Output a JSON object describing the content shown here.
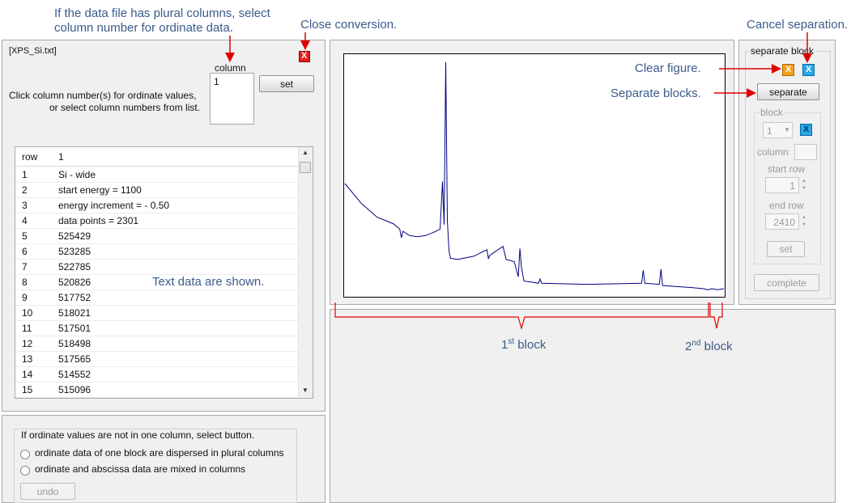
{
  "annotations": {
    "plural_columns": "If the data file has plural columns, select column number for ordinate data.",
    "plural_columns_line1": "If the data file has plural columns, select",
    "plural_columns_line2": "column number for ordinate data.",
    "close_conversion": "Close conversion.",
    "cancel_separation": "Cancel separation.",
    "clear_figure": "Clear figure.",
    "separate_blocks": "Separate blocks.",
    "text_data_shown": "Text data are shown.",
    "block1": {
      "num": "1",
      "sup": "st",
      "word": "block"
    },
    "block2": {
      "num": "2",
      "sup": "nd",
      "word": "block"
    }
  },
  "file_panel": {
    "filename": "[XPS_Si.txt]",
    "column_label": "column",
    "column_list": [
      "1"
    ],
    "set_label": "set",
    "instruction_line1": "Click column number(s) for ordinate values,",
    "instruction_line2": "or select column numbers from list.",
    "close_icon": "close-icon-x",
    "colors": {
      "close": "#e02020"
    }
  },
  "table": {
    "headers": [
      "row",
      "1"
    ],
    "rows": [
      [
        "1",
        "Si - wide"
      ],
      [
        "2",
        "start energy = 1100"
      ],
      [
        "3",
        "energy increment = - 0.50"
      ],
      [
        "4",
        "data points = 2301"
      ],
      [
        "5",
        "525429"
      ],
      [
        "6",
        "523285"
      ],
      [
        "7",
        "522785"
      ],
      [
        "8",
        "520826"
      ],
      [
        "9",
        "517752"
      ],
      [
        "10",
        "518021"
      ],
      [
        "11",
        "517501"
      ],
      [
        "12",
        "518498"
      ],
      [
        "13",
        "517565"
      ],
      [
        "14",
        "514552"
      ],
      [
        "15",
        "515096"
      ]
    ]
  },
  "ordinate_panel": {
    "instruction": "If ordinate values are not in one column, select button.",
    "option1": "ordinate data of one block are dispersed in plural columns",
    "option2": "ordinate and abscissa data are mixed in columns",
    "undo_label": "undo"
  },
  "separate_panel": {
    "group_label": "separate block",
    "separate_label": "separate",
    "block_group_label": "block",
    "block_value": "1",
    "column_label": "column",
    "start_row_label": "start row",
    "start_row_value": "1",
    "end_row_label": "end row",
    "end_row_value": "2410",
    "set_label": "set",
    "complete_label": "complete",
    "icons": {
      "clear": "clear-figure-icon-x",
      "cancel": "cancel-separation-icon-x",
      "block_cancel": "block-cancel-icon-x"
    },
    "colors": {
      "clear": "#f0a020",
      "cancel": "#28a8e8"
    }
  },
  "chart_data": {
    "type": "line",
    "description": "XPS wide spectrum profile (axes unlabeled)",
    "x": [
      0,
      20,
      40,
      60,
      68,
      70,
      72,
      80,
      90,
      100,
      110,
      118,
      121,
      123,
      125,
      127,
      129,
      131,
      140,
      160,
      176,
      178,
      180,
      196,
      200,
      210,
      215,
      217,
      219,
      222,
      232,
      240,
      242,
      244,
      300,
      368,
      370,
      372,
      390,
      392,
      394,
      410,
      430,
      445,
      450,
      455,
      462,
      470
    ],
    "y": [
      100,
      82,
      69,
      63,
      58,
      50,
      56,
      52,
      51,
      52,
      55,
      58,
      102,
      62,
      212,
      66,
      38,
      31,
      30,
      33,
      39,
      31,
      34,
      42,
      30,
      28,
      14,
      40,
      22,
      10,
      9,
      8,
      12,
      8,
      7,
      8,
      20,
      8,
      7,
      21,
      6,
      5,
      4,
      3,
      2,
      3,
      2,
      3
    ],
    "series_color": "#000080",
    "grid": false
  }
}
